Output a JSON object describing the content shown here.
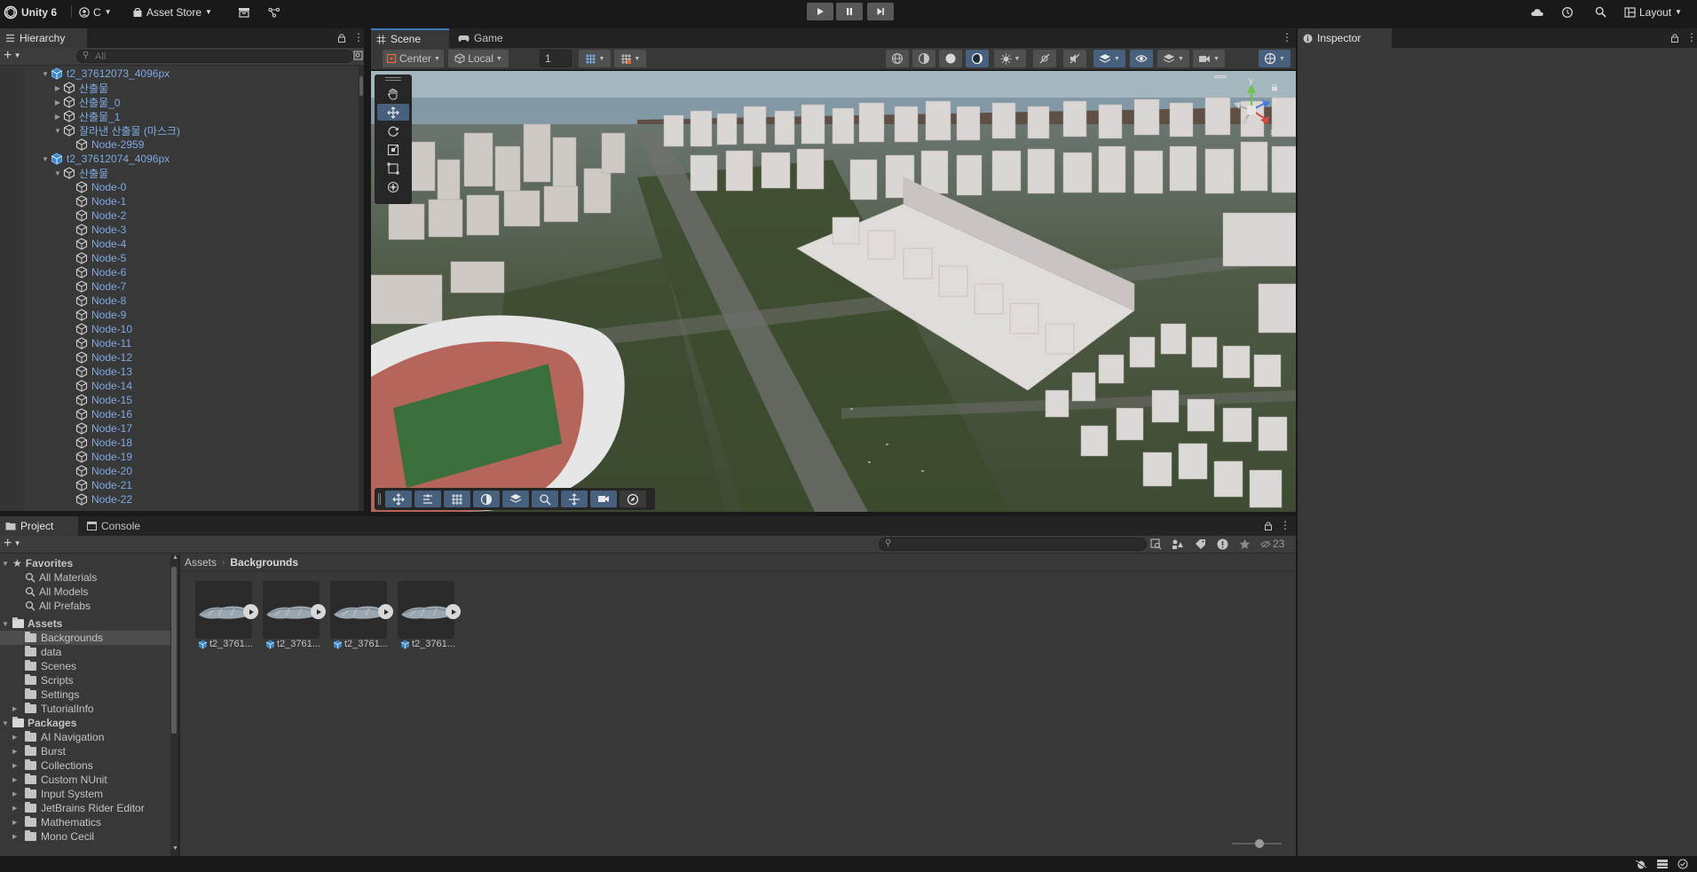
{
  "toolbar": {
    "app_name": "Unity 6",
    "account": "C",
    "asset_store": "Asset Store",
    "layout": "Layout"
  },
  "hierarchy": {
    "tab_label": "Hierarchy",
    "search_placeholder": "All",
    "rows": [
      {
        "label": "t2_37612073_4096px",
        "depth": 0,
        "expanded": true,
        "prefab": true
      },
      {
        "label": "산출물",
        "depth": 1,
        "expanded": false
      },
      {
        "label": "산출물_0",
        "depth": 1,
        "expanded": false
      },
      {
        "label": "산출물_1",
        "depth": 1,
        "expanded": false
      },
      {
        "label": "잘라낸 산출물 (마스크)",
        "depth": 1,
        "expanded": true
      },
      {
        "label": "Node-2959",
        "depth": 2
      },
      {
        "label": "t2_37612074_4096px",
        "depth": 0,
        "expanded": true,
        "prefab": true
      },
      {
        "label": "산출물",
        "depth": 1,
        "expanded": true
      },
      {
        "label": "Node-0",
        "depth": 2
      },
      {
        "label": "Node-1",
        "depth": 2
      },
      {
        "label": "Node-2",
        "depth": 2
      },
      {
        "label": "Node-3",
        "depth": 2
      },
      {
        "label": "Node-4",
        "depth": 2
      },
      {
        "label": "Node-5",
        "depth": 2
      },
      {
        "label": "Node-6",
        "depth": 2
      },
      {
        "label": "Node-7",
        "depth": 2
      },
      {
        "label": "Node-8",
        "depth": 2
      },
      {
        "label": "Node-9",
        "depth": 2
      },
      {
        "label": "Node-10",
        "depth": 2
      },
      {
        "label": "Node-11",
        "depth": 2
      },
      {
        "label": "Node-12",
        "depth": 2
      },
      {
        "label": "Node-13",
        "depth": 2
      },
      {
        "label": "Node-14",
        "depth": 2
      },
      {
        "label": "Node-15",
        "depth": 2
      },
      {
        "label": "Node-16",
        "depth": 2
      },
      {
        "label": "Node-17",
        "depth": 2
      },
      {
        "label": "Node-18",
        "depth": 2
      },
      {
        "label": "Node-19",
        "depth": 2
      },
      {
        "label": "Node-20",
        "depth": 2
      },
      {
        "label": "Node-21",
        "depth": 2
      },
      {
        "label": "Node-22",
        "depth": 2
      }
    ]
  },
  "scene": {
    "tab_scene": "Scene",
    "tab_game": "Game",
    "pivot_mode": "Center",
    "pivot_rotation": "Local",
    "grid_snap_value": "1",
    "gizmo_axes": {
      "y": "y",
      "z": "z",
      "x": "x"
    }
  },
  "project": {
    "tab_project": "Project",
    "tab_console": "Console",
    "hidden_count": "23",
    "breadcrumb": [
      "Assets",
      "Backgrounds"
    ],
    "favorites_label": "Favorites",
    "favorites": [
      "All Materials",
      "All Models",
      "All Prefabs"
    ],
    "assets_label": "Assets",
    "assets_folders": [
      "Backgrounds",
      "data",
      "Scenes",
      "Scripts",
      "Settings",
      "TutorialInfo"
    ],
    "packages_label": "Packages",
    "packages": [
      "AI Navigation",
      "Burst",
      "Collections",
      "Custom NUnit",
      "Input System",
      "JetBrains Rider Editor",
      "Mathematics",
      "Mono Cecil"
    ],
    "assets": [
      "t2_3761...",
      "t2_3761...",
      "t2_3761...",
      "t2_3761..."
    ]
  },
  "inspector": {
    "tab_label": "Inspector"
  }
}
